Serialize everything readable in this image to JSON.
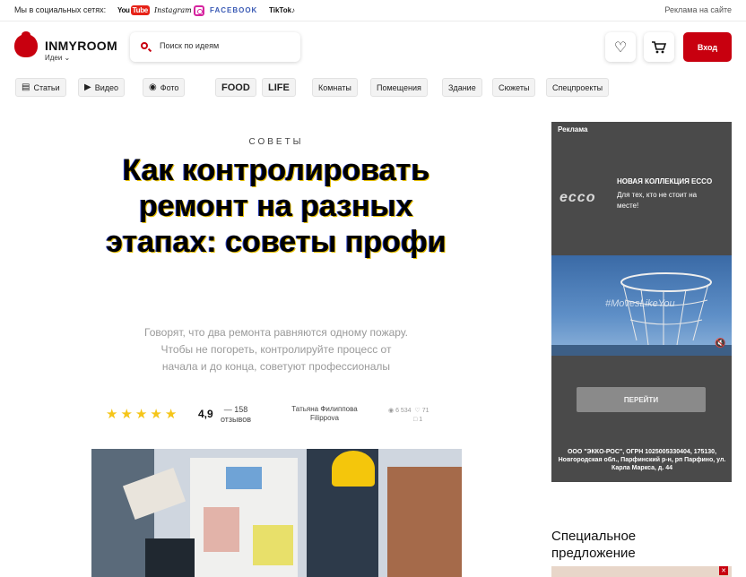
{
  "topbar": {
    "social_label": "Мы в социальных сетях:",
    "youtube_a": "You",
    "youtube_b": "Tube",
    "instagram": "Instagram",
    "facebook": "FACEBOOK",
    "tiktok": "TikTok",
    "ad_link": "Реклама на сайте"
  },
  "header": {
    "logo": "INMYROOM",
    "ideas": "Идеи ⌄",
    "search_placeholder": "Поиск по идеям",
    "login": "Вход"
  },
  "nav": {
    "articles": "Статьи",
    "video": "Видео",
    "photo": "Фото",
    "food": "FOOD",
    "life": "LIFE",
    "rooms": "Комнаты",
    "premises": "Помещения",
    "building": "Здание",
    "stories": "Сюжеты",
    "special": "Спецпроекты"
  },
  "article": {
    "category": "СОВЕТЫ",
    "title": "Как контролировать ремонт на разных этапах: советы профи",
    "lead": "Говорят, что два ремонта равняются одному пожару. Чтобы не погореть, контролируйте процесс от начала и до конца, советуют профессионалы",
    "rating": "4,9",
    "rating_stars": 5,
    "reviews_count": "— 158",
    "reviews_label": "отзывов",
    "author": "Татьяна Филиппова Filippova",
    "views": "6 534",
    "likes": "71",
    "comments": "1"
  },
  "ad": {
    "label": "Реклама",
    "brand": "ecco",
    "collection": "НОВАЯ КОЛЛЕКЦИЯ ECCO",
    "subtitle": "Для тех, кто не стоит на месте!",
    "hashtag": "#MovesLikeYou",
    "cta": "ПЕРЕЙТИ",
    "legal": "ООО \"ЭККО-РОС\", ОГРН 1025005330404, 175130, Новгородская обл., Парфинский р-н, рп Парфино, ул. Карла Маркса, д. 44"
  },
  "sidebar": {
    "special_offer": "Специальное предложение"
  },
  "colors": {
    "brand_red": "#c8000f",
    "star": "#f5c518",
    "ad_bg": "#4a4a4a"
  }
}
